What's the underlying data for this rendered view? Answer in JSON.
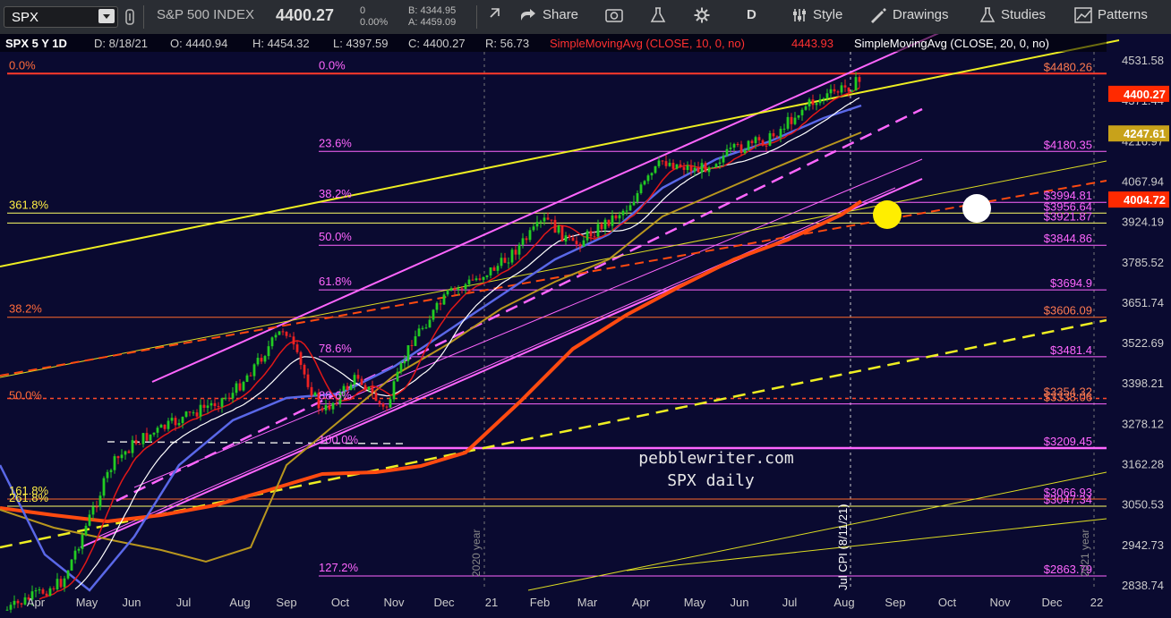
{
  "toolbar": {
    "symbol": "SPX",
    "name": "S&P 500 INDEX",
    "last": "4400.27",
    "change": "0",
    "change_pct": "0.00%",
    "bid": "B: 4344.95",
    "ask": "A: 4459.09",
    "share": "Share",
    "period": "D",
    "style": "Style",
    "drawings": "Drawings",
    "studies": "Studies",
    "patterns": "Patterns"
  },
  "chart_data": {
    "type": "candlestick",
    "title": "pebblewriter.com",
    "subtitle": "SPX daily",
    "header": {
      "symbol_period": "SPX 5 Y 1D",
      "date": "D: 8/18/21",
      "open": "O: 4440.94",
      "high": "H: 4454.32",
      "low": "L: 4397.59",
      "close": "C: 4400.27",
      "range": "R: 56.73",
      "sma10_label": "SimpleMovingAvg (CLOSE, 10, 0, no)",
      "sma10_value": "4443.93",
      "sma20_label": "SimpleMovingAvg (CLOSE, 20, 0, no)"
    },
    "y_ticks": [
      "4531.58",
      "4371.44",
      "4216.97",
      "4067.94",
      "3924.19",
      "3785.52",
      "3651.74",
      "3522.69",
      "3398.21",
      "3278.12",
      "3162.28",
      "3050.53",
      "2942.73",
      "2838.74"
    ],
    "x_ticks": [
      "Apr",
      "May",
      "Jun",
      "Jul",
      "Aug",
      "Sep",
      "Oct",
      "Nov",
      "Dec",
      "21",
      "Feb",
      "Mar",
      "Apr",
      "May",
      "Jun",
      "Jul",
      "Aug",
      "Sep",
      "Oct",
      "Nov",
      "Dec",
      "22"
    ],
    "price_badges": [
      {
        "text": "4400.27",
        "color": "#ff2a00",
        "value": 4400.27
      },
      {
        "text": "4247.61",
        "color": "#c8a21a",
        "value": 4247.61
      },
      {
        "text": "4004.72",
        "color": "#ff2a00",
        "value": 4004.72
      }
    ],
    "fib_right_labels": [
      {
        "pct": "0.0%",
        "price": "$4480.26",
        "value": 4480.26
      },
      {
        "pct": "23.6%",
        "price": "$4180.35",
        "value": 4180.35
      },
      {
        "pct": "38.2%",
        "price": "$3994.81",
        "value": 3994.81
      },
      {
        "pct": "",
        "price": "$3956.64",
        "value": 3956.64
      },
      {
        "pct": "",
        "price": "$3921.87",
        "value": 3921.87
      },
      {
        "pct": "50.0%",
        "price": "$3844.86",
        "value": 3844.86
      },
      {
        "pct": "61.8%",
        "price": "$3694.9",
        "value": 3694.9
      },
      {
        "pct": "",
        "price": "$3606.09",
        "value": 3606.09
      },
      {
        "pct": "78.6%",
        "price": "$3481.4",
        "value": 3481.4
      },
      {
        "pct": "",
        "price": "$3354.32",
        "value": 3354.32
      },
      {
        "pct": "88.6%",
        "price": "$3338.06",
        "value": 3338.06
      },
      {
        "pct": "100.0%",
        "price": "$3209.45",
        "value": 3209.45
      },
      {
        "pct": "",
        "price": "$3066.93",
        "value": 3066.93
      },
      {
        "pct": "",
        "price": "$3047.34",
        "value": 3047.34
      },
      {
        "pct": "127.2%",
        "price": "$2863.79",
        "value": 2863.79
      }
    ],
    "fib_left_labels": [
      {
        "text": "0.0%",
        "value": 4480.26
      },
      {
        "text": "361.8%",
        "value": 3956.64
      },
      {
        "text": "38.2%",
        "value": 3606.09
      },
      {
        "text": "50.0%",
        "value": 3338.06
      },
      {
        "text": "161.8%",
        "value": 3066.93
      },
      {
        "text": "261.8%",
        "value": 3047.34
      }
    ],
    "vertical_labels": [
      "2020 year",
      "2021 year",
      "Jul CPI (8/11/21)"
    ],
    "grid": false,
    "legend": "none",
    "colors": {
      "background": "#0a0a30",
      "candle_up": "#22cc22",
      "candle_down": "#ee2222",
      "fib": "#ff66ff",
      "sma200": "#ff4a10",
      "trend": "#ffff33"
    }
  }
}
